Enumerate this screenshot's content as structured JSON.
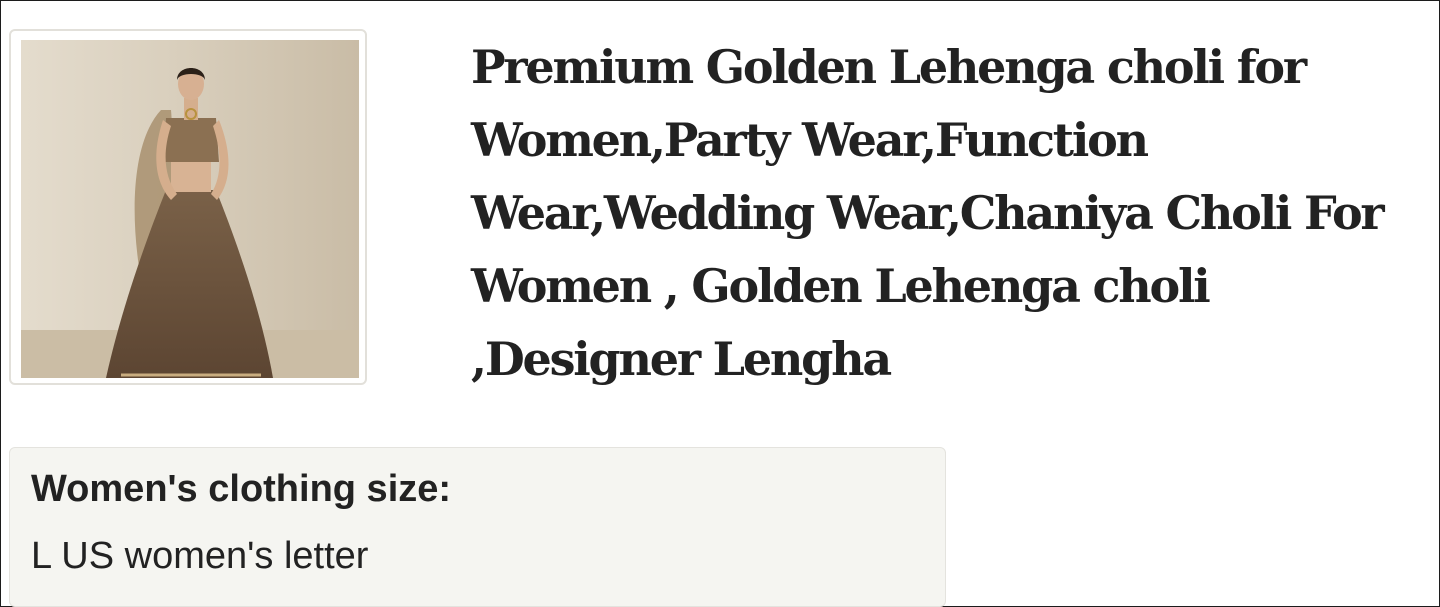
{
  "product": {
    "title": "Premium Golden Lehenga choli for Women,Party Wear,Function Wear,Wedding Wear,Chaniya Choli For Women , Golden Lehenga choli ,Designer Lengha",
    "image_icon": "product-photo-woman-in-golden-lehenga"
  },
  "variation": {
    "label": "Women's clothing size:",
    "value": "L US women's letter"
  }
}
